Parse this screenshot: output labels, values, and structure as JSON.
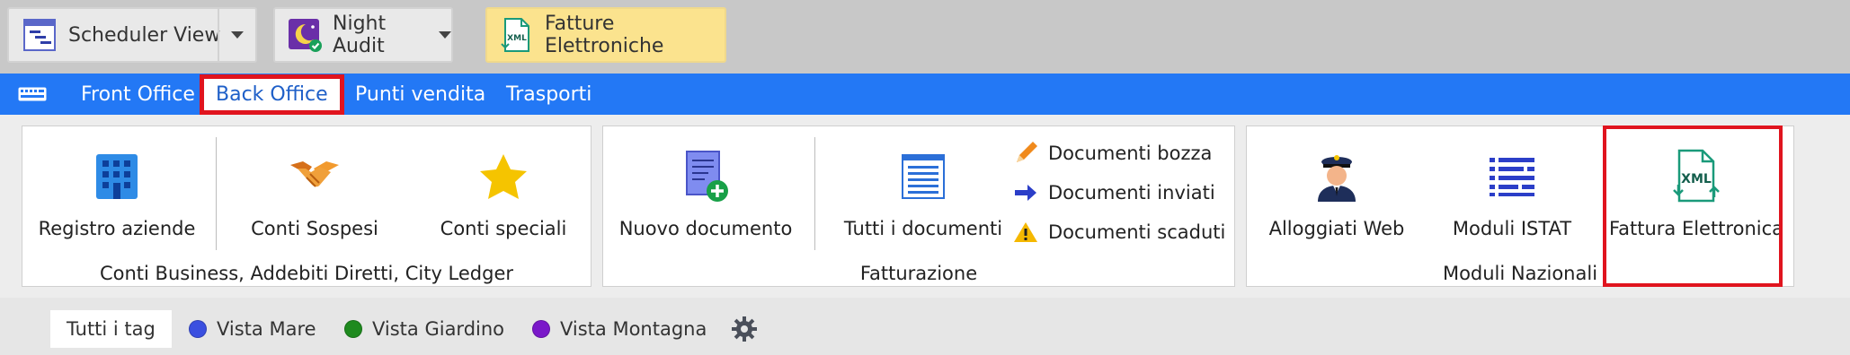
{
  "toolbar": {
    "scheduler_label": "Scheduler View",
    "night_audit_label": "Night Audit",
    "fatture_label": "Fatture Elettroniche",
    "fatture_icon_text": "XML"
  },
  "nav": {
    "menu_icon": "keyboard-icon",
    "items": [
      {
        "label": "Front Office"
      },
      {
        "label": "Back Office"
      },
      {
        "label": "Punti vendita"
      },
      {
        "label": "Trasporti"
      }
    ],
    "active": "Back Office"
  },
  "ribbon": {
    "group1": {
      "caption": "Conti Business, Addebiti Diretti, City Ledger",
      "items": [
        {
          "label": "Registro aziende",
          "icon": "building-icon"
        },
        {
          "label": "Conti Sospesi",
          "icon": "handshake-icon"
        },
        {
          "label": "Conti speciali",
          "icon": "star-icon"
        }
      ]
    },
    "group2": {
      "caption": "Fatturazione",
      "items": [
        {
          "label": "Nuovo documento",
          "icon": "new-document-icon"
        },
        {
          "label": "Tutti i documenti",
          "icon": "documents-list-icon"
        }
      ],
      "small_items": [
        {
          "label": "Documenti bozza",
          "icon": "pencil-icon"
        },
        {
          "label": "Documenti inviati",
          "icon": "arrow-right-icon"
        },
        {
          "label": "Documenti scaduti",
          "icon": "warning-icon"
        }
      ]
    },
    "group3": {
      "caption": "Moduli Nazionali",
      "items": [
        {
          "label": "Alloggiati Web",
          "icon": "police-officer-icon"
        },
        {
          "label": "Moduli ISTAT",
          "icon": "list-icon"
        },
        {
          "label": "Fattura Elettronica",
          "icon": "xml-file-icon",
          "icon_text": "XML"
        }
      ]
    }
  },
  "tags": {
    "items": [
      {
        "label": "Tutti i tag"
      },
      {
        "label": "Vista Mare",
        "color": "#3a4fe0"
      },
      {
        "label": "Vista Giardino",
        "color": "#1e8a1e"
      },
      {
        "label": "Vista Montagna",
        "color": "#7a18c9"
      }
    ],
    "settings_icon": "gear-icon"
  },
  "colors": {
    "nav_bar": "#2378f5",
    "highlight": "#e0141e",
    "fatture_button": "#fbe38e"
  }
}
